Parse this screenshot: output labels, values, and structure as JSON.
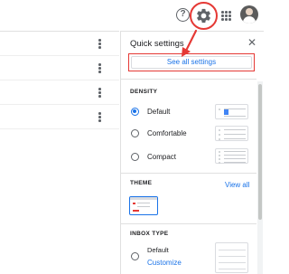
{
  "header": {
    "help_icon": "help-circle-icon",
    "help_glyph": "?",
    "settings_icon": "gear-icon",
    "apps_icon": "apps-grid-icon",
    "avatar": "user-avatar"
  },
  "quick_settings": {
    "title": "Quick settings",
    "close_icon": "close-icon",
    "close_glyph": "✕",
    "see_all_label": "See all settings",
    "density": {
      "label": "DENSITY",
      "options": [
        {
          "label": "Default",
          "selected": true
        },
        {
          "label": "Comfortable",
          "selected": false
        },
        {
          "label": "Compact",
          "selected": false
        }
      ]
    },
    "theme": {
      "label": "THEME",
      "view_all_label": "View all"
    },
    "inbox_type": {
      "label": "INBOX TYPE",
      "default_label": "Default",
      "customize_label": "Customize"
    }
  },
  "colors": {
    "highlight": "#e53935",
    "accent": "#1a73e8"
  }
}
